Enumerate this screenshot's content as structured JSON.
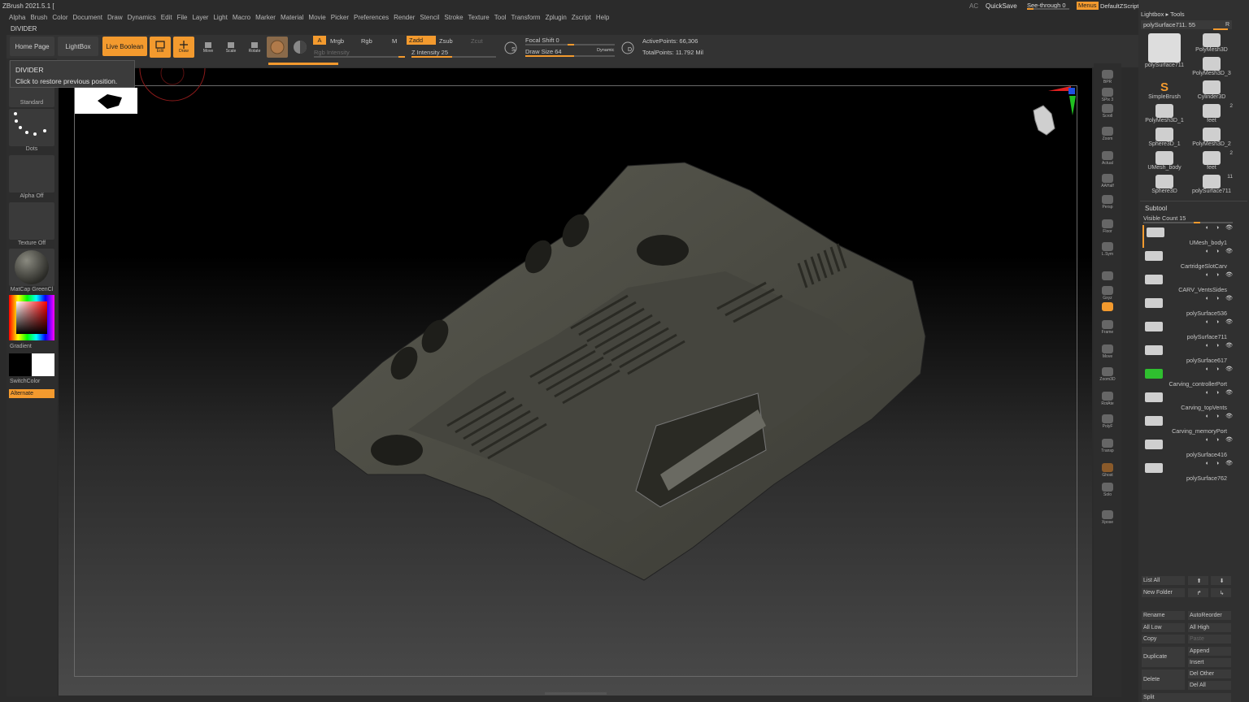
{
  "title": "ZBrush 2021.5.1 [",
  "titlebar_right": {
    "ac": "AC",
    "quicksave": "QuickSave",
    "see_through": "See-through  0",
    "menus": "Menus",
    "script": "DefaultZScript"
  },
  "menus": [
    "Alpha",
    "Brush",
    "Color",
    "Document",
    "Draw",
    "Dynamics",
    "Edit",
    "File",
    "Layer",
    "Light",
    "Macro",
    "Marker",
    "Material",
    "Movie",
    "Picker",
    "Preferences",
    "Render",
    "Stencil",
    "Stroke",
    "Texture",
    "Tool",
    "Transform",
    "Zplugin",
    "Zscript",
    "Help"
  ],
  "divider_label": "DIVIDER",
  "tooltip": {
    "title": "DIVIDER",
    "body": "Click to restore previous position."
  },
  "shelf": {
    "home_page": "Home Page",
    "lightbox": "LightBox",
    "live_boolean": "Live Boolean",
    "edit": "Edit",
    "draw": "Draw",
    "move": "Move",
    "scale": "Scale",
    "rotate": "Rotate",
    "a": "A",
    "mrgb": "Mrgb",
    "rgb": "Rgb",
    "m": "M",
    "rgb_intensity": "Rgb Intensity",
    "zadd": "Zadd",
    "zsub": "Zsub",
    "zcut": "Zcut",
    "z_intensity": "Z Intensity 25",
    "focal_shift": "Focal Shift 0",
    "draw_size": "Draw Size 64",
    "dynamic": "Dynamic",
    "active_points": "ActivePoints: 66,306",
    "total_points": "TotalPoints: 11.792 Mil"
  },
  "left": {
    "brush": "Standard",
    "stroke": "Dots",
    "alpha": "Alpha Off",
    "texture": "Texture Off",
    "material": "MatCap GreenCl",
    "gradient": "Gradient",
    "switchcolor": "SwitchColor",
    "alternate": "Alternate"
  },
  "right_shelf": [
    {
      "label": "BPR",
      "name": "bpr-button"
    },
    {
      "label": "SPix 3",
      "name": "spix-slider"
    },
    {
      "label": "Scroll",
      "name": "scroll-button"
    },
    {
      "label": "Zoom",
      "name": "zoom-button"
    },
    {
      "label": "Actual",
      "name": "actual-button"
    },
    {
      "label": "AAHalf",
      "name": "aahalf-button"
    },
    {
      "label": "Persp",
      "name": "persp-button"
    },
    {
      "label": "Floor",
      "name": "floor-button"
    },
    {
      "label": "L.Sym",
      "name": "lsym-button"
    },
    {
      "label": "",
      "name": "lock-button"
    },
    {
      "label": "Gxyz",
      "name": "xyz-button"
    },
    {
      "label": "",
      "name": "rotate-axis-button"
    },
    {
      "label": "Frame",
      "name": "frame-button"
    },
    {
      "label": "Move",
      "name": "move-view-button"
    },
    {
      "label": "Zoom3D",
      "name": "zoom3d-button"
    },
    {
      "label": "RotAte",
      "name": "rotate-view-button"
    },
    {
      "label": "PolyF",
      "name": "polyf-button"
    },
    {
      "label": "Transp",
      "name": "transp-button"
    },
    {
      "label": "Ghost",
      "name": "ghost-button"
    },
    {
      "label": "Solo",
      "name": "solo-button"
    },
    {
      "label": "Xpose",
      "name": "xpose-button"
    }
  ],
  "tray": {
    "header": "Lightbox ▸ Tools",
    "current_tool": "polySurface711. 55",
    "r": "R",
    "tools": [
      {
        "label": "polySurface711",
        "badge": ""
      },
      {
        "label": "PolyMesh3D",
        "badge": ""
      },
      {
        "label": "",
        "badge": ""
      },
      {
        "label": "PolyMesh3D_3",
        "badge": ""
      },
      {
        "label": "SimpleBrush",
        "badge": ""
      },
      {
        "label": "Cylinder3D",
        "badge": ""
      },
      {
        "label": "PolyMesh3D_1",
        "badge": ""
      },
      {
        "label": "feet",
        "badge": "2"
      },
      {
        "label": "Sphere3D_1",
        "badge": ""
      },
      {
        "label": "PolyMesh3D_2",
        "badge": ""
      },
      {
        "label": "UMesh_body",
        "badge": ""
      },
      {
        "label": "feet",
        "badge": "2"
      },
      {
        "label": "Sphere3D",
        "badge": ""
      },
      {
        "label": "polySurface711",
        "badge": "11"
      }
    ],
    "subtool_header": "Subtool",
    "visible_count": "Visible Count 15",
    "subtools": [
      "UMesh_body1",
      "CartridgeSlotCarv",
      "CARV_VentsSides",
      "polySurface536",
      "polySurface711",
      "polySurface617",
      "Carving_controllerPort",
      "Carving_topVents",
      "Carving_memoryPort",
      "polySurface416",
      "polySurface762"
    ],
    "buttons": {
      "list_all": "List All",
      "new_folder": "New Folder",
      "rename": "Rename",
      "auto_reorder": "AutoReorder",
      "all_low": "All Low",
      "all_high": "All High",
      "copy": "Copy",
      "paste": "Paste",
      "duplicate": "Duplicate",
      "append": "Append",
      "insert": "Insert",
      "delete": "Delete",
      "del_other": "Del Other",
      "del_all": "Del All",
      "split": "Split"
    }
  },
  "colors": {
    "accent": "#f39a2e",
    "panel": "#2d2d2d",
    "model": "#4a4a40"
  }
}
